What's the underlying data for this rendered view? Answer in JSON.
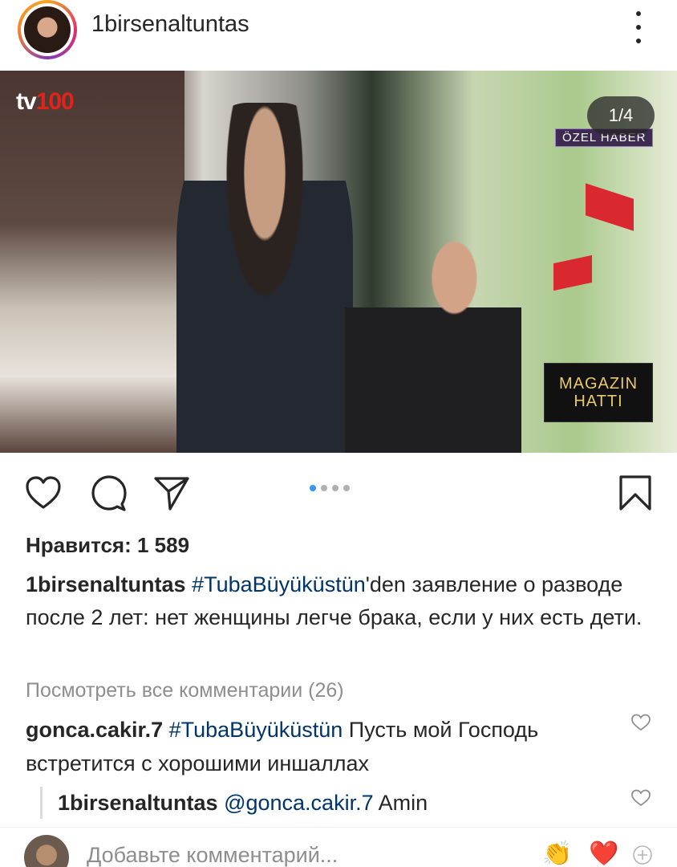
{
  "header": {
    "username": "1birsenaltuntas",
    "avatar_icon": "profile-avatar",
    "more_icon": "more-vertical-icon"
  },
  "media": {
    "counter": "1/4",
    "channel_logo_prefix": "tv",
    "channel_logo_number": "100",
    "overlay_tag": "ÖZEL HABER",
    "overlay_brand_line1": "MAGAZIN",
    "overlay_brand_line2": "HATTI",
    "carousel": {
      "total": 4,
      "active_index": 0
    }
  },
  "actions": {
    "like_icon": "heart-outline-icon",
    "comment_icon": "comment-bubble-icon",
    "share_icon": "paper-plane-icon",
    "save_icon": "bookmark-outline-icon"
  },
  "likes": {
    "label": "Нравится: 1 589"
  },
  "caption": {
    "user": "1birsenaltuntas",
    "hashtag": "#TubaBüyüküstün",
    "text": "'den заявление о разводе после 2 лет: нет женщины легче брака, если у них есть дети."
  },
  "view_all_comments": "Посмотреть все комментарии (26)",
  "comments": [
    {
      "user": "gonca.cakir.7",
      "hashtag": "#TubaBüyüküstün",
      "text": " Пусть мой Господь встретится с хорошими иншаллах",
      "heart_icon": "heart-outline-icon"
    }
  ],
  "reply": {
    "user": "1birsenaltuntas",
    "mention": "@gonca.cakir.7",
    "text": " Amin",
    "heart_icon": "heart-outline-icon"
  },
  "add_comment": {
    "placeholder": "Добавьте комментарий...",
    "emoji_1": "👏",
    "emoji_2": "❤️",
    "plus_icon": "add-circle-icon"
  },
  "colors": {
    "accent_blue": "#3897f0",
    "hashtag": "#003569",
    "muted": "#8e8e8e",
    "text": "#262626"
  }
}
